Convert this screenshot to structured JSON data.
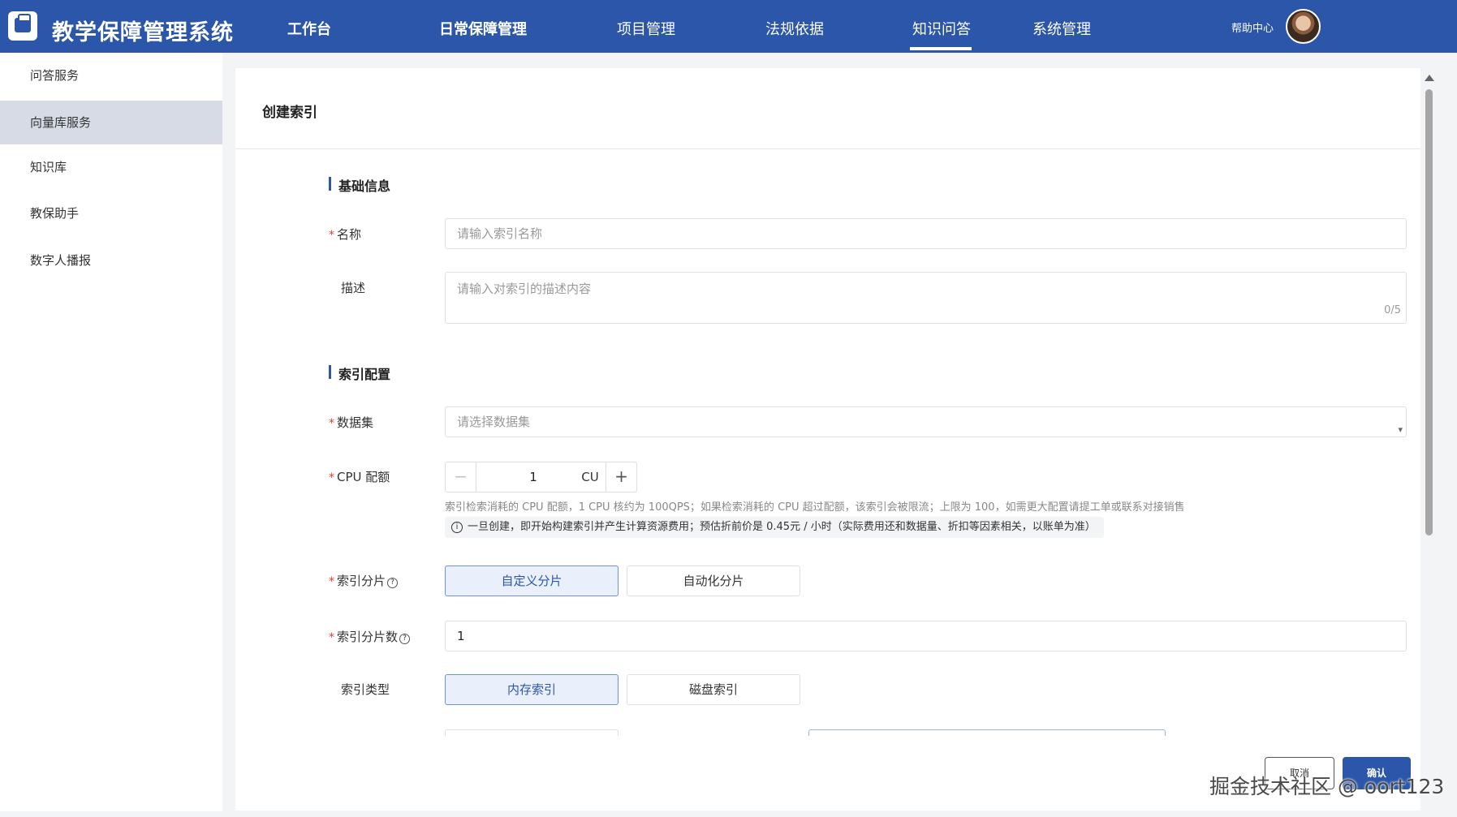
{
  "header": {
    "app_title": "教学保障管理系统",
    "nav": [
      "工作台",
      "日常保障管理",
      "项目管理",
      "法规依据",
      "知识问答",
      "系统管理"
    ],
    "active_nav": "知识问答",
    "help_label": "帮助中心"
  },
  "sidebar": {
    "items": [
      "问答服务",
      "向量库服务",
      "知识库",
      "教保助手",
      "数字人播报"
    ],
    "active_item": "向量库服务"
  },
  "form": {
    "title": "创建索引",
    "section_basic": "基础信息",
    "name_label": "名称",
    "name_placeholder": "请输入索引名称",
    "desc_label": "描述",
    "desc_placeholder": "请输入对索引的描述内容",
    "desc_counter": "0/5",
    "section_index": "索引配置",
    "dataset_label": "数据集",
    "dataset_placeholder": "请选择数据集",
    "cpu_label": "CPU 配额",
    "cpu_value": "1",
    "cpu_unit": "CU",
    "cpu_hint": "索引检索消耗的 CPU 配额，1 CPU 核约为 100QPS；如果检索消耗的 CPU 超过配额，该索引会被限流；上限为 100，如需更大配置请提工单或联系对接销售",
    "cpu_notice": "一旦创建，即开始构建索引并产生计算资源费用；预估折前价是 0.45元 / 小时（实际费用还和数据量、折扣等因素相关，以账单为准）",
    "shard_label": "索引分片",
    "shard_options": [
      "自定义分片",
      "自动化分片"
    ],
    "shard_selected": "自定义分片",
    "shard_count_label": "索引分片数",
    "shard_count_value": "1",
    "index_type_label": "索引类型",
    "index_type_options": [
      "内存索引",
      "磁盘索引"
    ],
    "index_type_selected": "内存索引"
  },
  "footer": {
    "cancel_label": "取消",
    "confirm_label": "确认",
    "watermark": "掘金技术社区 @ oort123"
  },
  "colors": {
    "brand": "#2b56a9",
    "required": "#e53935",
    "active_segment_bg": "#eaf0fb"
  }
}
